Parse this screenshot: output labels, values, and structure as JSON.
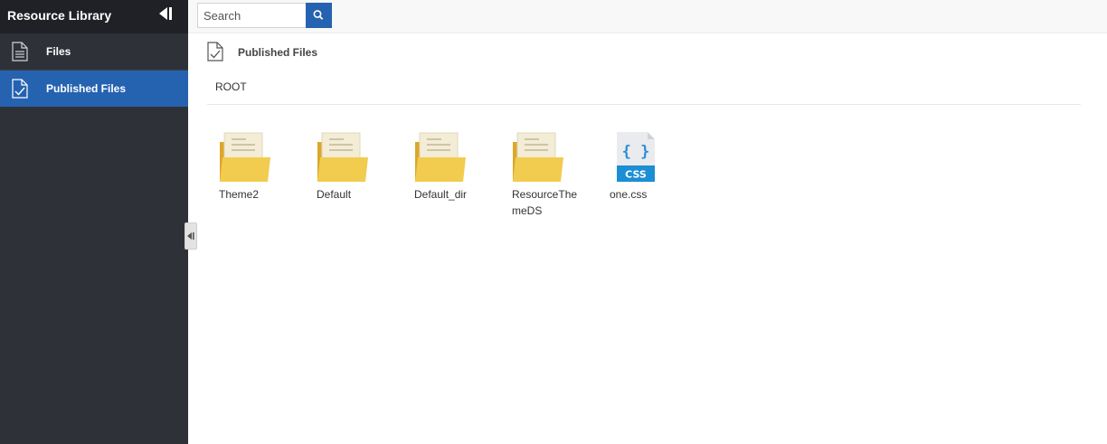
{
  "sidebar": {
    "title": "Resource Library",
    "items": [
      {
        "label": "Files",
        "icon": "document-icon"
      },
      {
        "label": "Published Files",
        "icon": "published-document-icon"
      }
    ]
  },
  "search": {
    "placeholder": "Search"
  },
  "content": {
    "title": "Published Files",
    "breadcrumb": "ROOT",
    "items": [
      {
        "label": "Theme2",
        "type": "folder"
      },
      {
        "label": "Default",
        "type": "folder"
      },
      {
        "label": "Default_dir",
        "type": "folder"
      },
      {
        "label": "ResourceThemeDS",
        "type": "folder"
      },
      {
        "label": "one.css",
        "type": "css-file",
        "badge": "CSS"
      }
    ]
  },
  "colors": {
    "sidebar_bg": "#2f3138",
    "sidebar_header_bg": "#1f2126",
    "active": "#2563b0",
    "folder": "#f2cc4e"
  }
}
